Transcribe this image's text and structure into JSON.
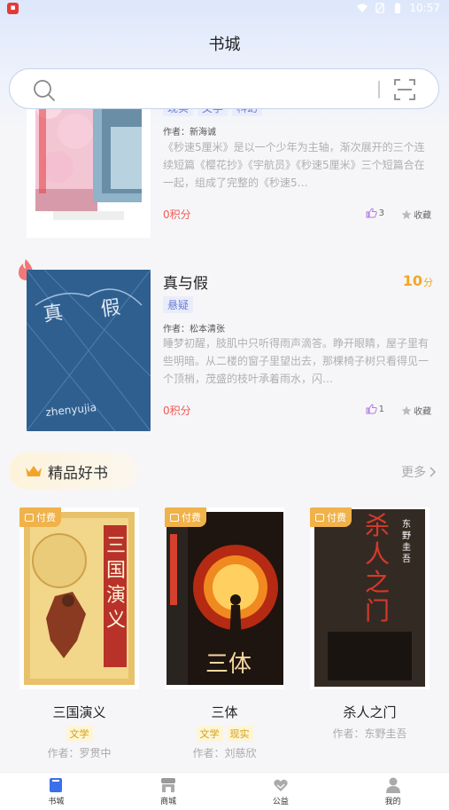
{
  "status": {
    "time": "10:57",
    "icons": [
      "wifi-icon",
      "sim-icon",
      "battery-icon"
    ]
  },
  "header": {
    "title": "书城"
  },
  "search": {
    "placeholder": ""
  },
  "books": [
    {
      "title": "",
      "tags": [
        "现实",
        "文学",
        "科幻"
      ],
      "author": "作者：新海诚",
      "desc": "《秒速5厘米》是以一个少年为主轴，渐次展开的三个连续短篇《樱花抄》《宇航员》《秒速5厘米》三个短篇合在一起，组成了完整的《秒速5…",
      "points": "0积分",
      "likes": "3",
      "fav": "收藏"
    },
    {
      "title": "真与假",
      "score": "10",
      "score_unit": "分",
      "tags": [
        "悬疑"
      ],
      "author": "作者：松本清张",
      "desc": "睡梦初醒，肢肌中只听得雨声滴答。睁开眼睛，屋子里有些明暗。从二楼的窗子里望出去，那棵椅子树只看得见一个顶梢，茂盛的枝叶承着雨水，闪…",
      "points": "0积分",
      "likes": "1",
      "fav": "收藏"
    }
  ],
  "section": {
    "title": "精品好书",
    "more": "更多"
  },
  "premium": [
    {
      "badge": "付费",
      "title": "三国演义",
      "tags": [
        "文学"
      ],
      "author": "作者：罗贯中"
    },
    {
      "badge": "付费",
      "title": "三体",
      "tags": [
        "文学",
        "现实"
      ],
      "author": "作者：刘慈欣"
    },
    {
      "badge": "付费",
      "title": "杀人之门",
      "tags": [],
      "author": "作者：东野圭吾"
    }
  ],
  "tabs": [
    {
      "label": "书城",
      "icon": "book-icon"
    },
    {
      "label": "商城",
      "icon": "store-icon"
    },
    {
      "label": "公益",
      "icon": "heart-hands-icon"
    },
    {
      "label": "我的",
      "icon": "user-icon"
    }
  ],
  "colors": {
    "accent": "#6d7fd4",
    "score": "#f5a623",
    "points": "#f05a5a",
    "paid": "#f0b24a"
  }
}
